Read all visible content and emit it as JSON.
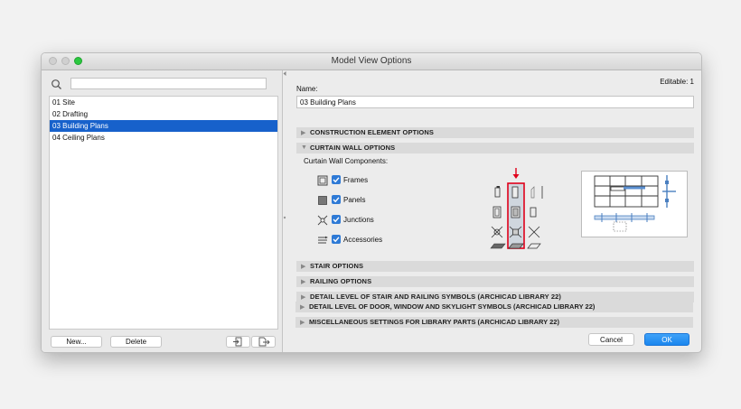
{
  "window": {
    "title": "Model View Options"
  },
  "sidebar": {
    "search_placeholder": "",
    "items": [
      "01 Site",
      "02 Drafting",
      "03 Building Plans",
      "04 Ceiling Plans"
    ],
    "selected_index": 2,
    "new_label": "New...",
    "delete_label": "Delete"
  },
  "main": {
    "editable_label": "Editable: 1",
    "name_label": "Name:",
    "name_value": "03 Building Plans",
    "sections": [
      "CONSTRUCTION ELEMENT OPTIONS",
      "CURTAIN WALL OPTIONS",
      "STAIR OPTIONS",
      "RAILING OPTIONS",
      "DETAIL LEVEL OF STAIR AND RAILING SYMBOLS (ARCHICAD LIBRARY 22)",
      "DETAIL LEVEL OF DOOR, WINDOW AND SKYLIGHT SYMBOLS (ARCHICAD LIBRARY 22)",
      "MISCELLANEOUS SETTINGS FOR LIBRARY PARTS (ARCHICAD LIBRARY 22)"
    ],
    "curtain_wall": {
      "components_label": "Curtain Wall Components:",
      "components": [
        "Frames",
        "Panels",
        "Junctions",
        "Accessories"
      ]
    },
    "cancel_label": "Cancel",
    "ok_label": "OK"
  },
  "colors": {
    "accent": "#1761cb",
    "ok_button": "#1a8cf0",
    "highlight": "#e0001a"
  }
}
